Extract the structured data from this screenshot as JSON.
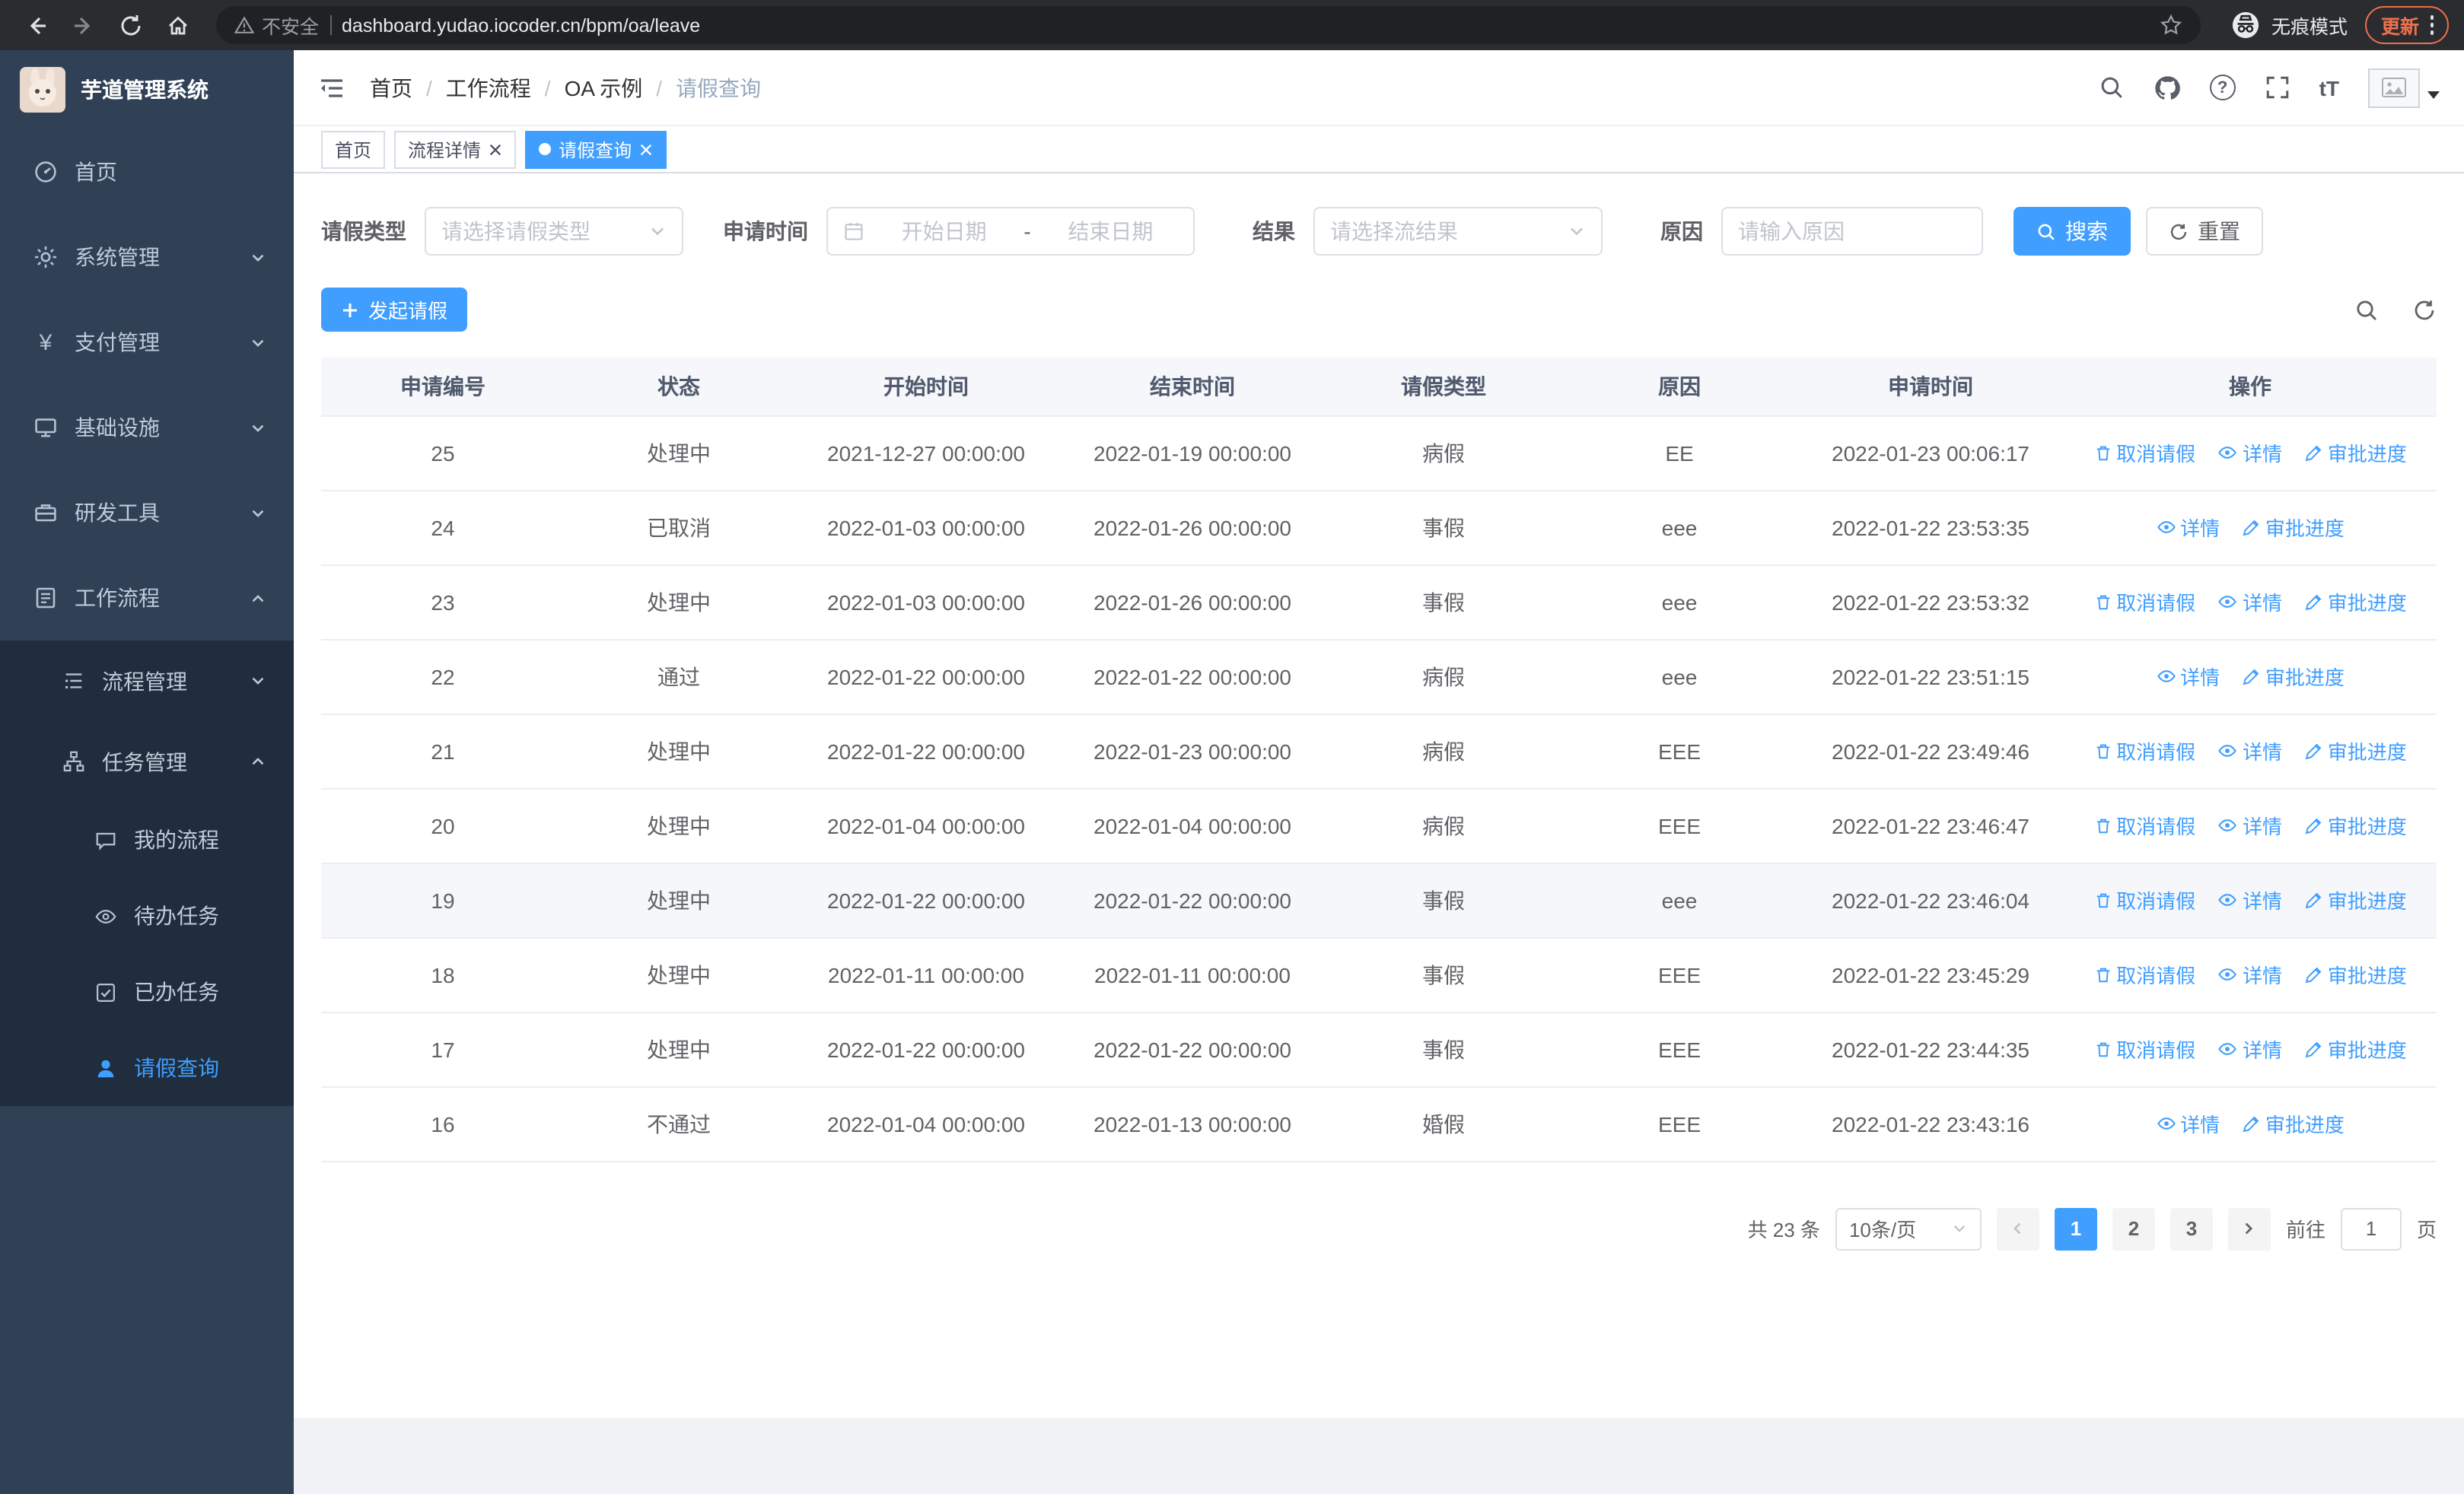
{
  "browser": {
    "security_label": "不安全",
    "url": "dashboard.yudao.iocoder.cn/bpm/oa/leave",
    "incognito_label": "无痕模式",
    "update_label": "更新"
  },
  "sidebar": {
    "title": "芋道管理系统",
    "yen_glyph": "¥",
    "items": [
      {
        "label": "首页"
      },
      {
        "label": "系统管理"
      },
      {
        "label": "支付管理"
      },
      {
        "label": "基础设施"
      },
      {
        "label": "研发工具"
      },
      {
        "label": "工作流程"
      },
      {
        "label": "流程管理"
      },
      {
        "label": "任务管理"
      },
      {
        "label": "我的流程"
      },
      {
        "label": "待办任务"
      },
      {
        "label": "已办任务"
      },
      {
        "label": "请假查询"
      }
    ]
  },
  "breadcrumb": [
    "首页",
    "工作流程",
    "OA 示例",
    "请假查询"
  ],
  "breadcrumb_sep": "/",
  "header_icons": {
    "help_glyph": "?",
    "font_glyph": "tT"
  },
  "tabs": [
    {
      "label": "首页"
    },
    {
      "label": "流程详情"
    },
    {
      "label": "请假查询"
    }
  ],
  "filters": {
    "leave_type_label": "请假类型",
    "leave_type_placeholder": "请选择请假类型",
    "time_label": "申请时间",
    "start_date_placeholder": "开始日期",
    "range_separator": "-",
    "end_date_placeholder": "结束日期",
    "result_label": "结果",
    "result_placeholder": "请选择流结果",
    "reason_label": "原因",
    "reason_placeholder": "请输入原因",
    "search_button": "搜索",
    "reset_button": "重置"
  },
  "toolbar": {
    "create_label": "发起请假"
  },
  "table": {
    "headers": [
      "申请编号",
      "状态",
      "开始时间",
      "结束时间",
      "请假类型",
      "原因",
      "申请时间",
      "操作"
    ],
    "rows": [
      {
        "id": "25",
        "status": "处理中",
        "start": "2021-12-27 00:00:00",
        "end": "2022-01-19 00:00:00",
        "type": "病假",
        "reason": "EE",
        "applied": "2022-01-23 00:06:17",
        "cancel": "取消请假",
        "details": "详情",
        "progress": "审批进度"
      },
      {
        "id": "24",
        "status": "已取消",
        "start": "2022-01-03 00:00:00",
        "end": "2022-01-26 00:00:00",
        "type": "事假",
        "reason": "eee",
        "applied": "2022-01-22 23:53:35",
        "details": "详情",
        "progress": "审批进度"
      },
      {
        "id": "23",
        "status": "处理中",
        "start": "2022-01-03 00:00:00",
        "end": "2022-01-26 00:00:00",
        "type": "事假",
        "reason": "eee",
        "applied": "2022-01-22 23:53:32",
        "cancel": "取消请假",
        "details": "详情",
        "progress": "审批进度"
      },
      {
        "id": "22",
        "status": "通过",
        "start": "2022-01-22 00:00:00",
        "end": "2022-01-22 00:00:00",
        "type": "病假",
        "reason": "eee",
        "applied": "2022-01-22 23:51:15",
        "details": "详情",
        "progress": "审批进度"
      },
      {
        "id": "21",
        "status": "处理中",
        "start": "2022-01-22 00:00:00",
        "end": "2022-01-23 00:00:00",
        "type": "病假",
        "reason": "EEE",
        "applied": "2022-01-22 23:49:46",
        "cancel": "取消请假",
        "details": "详情",
        "progress": "审批进度"
      },
      {
        "id": "20",
        "status": "处理中",
        "start": "2022-01-04 00:00:00",
        "end": "2022-01-04 00:00:00",
        "type": "病假",
        "reason": "EEE",
        "applied": "2022-01-22 23:46:47",
        "cancel": "取消请假",
        "details": "详情",
        "progress": "审批进度"
      },
      {
        "id": "19",
        "status": "处理中",
        "start": "2022-01-22 00:00:00",
        "end": "2022-01-22 00:00:00",
        "type": "事假",
        "reason": "eee",
        "applied": "2022-01-22 23:46:04",
        "cancel": "取消请假",
        "details": "详情",
        "progress": "审批进度"
      },
      {
        "id": "18",
        "status": "处理中",
        "start": "2022-01-11 00:00:00",
        "end": "2022-01-11 00:00:00",
        "type": "事假",
        "reason": "EEE",
        "applied": "2022-01-22 23:45:29",
        "cancel": "取消请假",
        "details": "详情",
        "progress": "审批进度"
      },
      {
        "id": "17",
        "status": "处理中",
        "start": "2022-01-22 00:00:00",
        "end": "2022-01-22 00:00:00",
        "type": "事假",
        "reason": "EEE",
        "applied": "2022-01-22 23:44:35",
        "cancel": "取消请假",
        "details": "详情",
        "progress": "审批进度"
      },
      {
        "id": "16",
        "status": "不通过",
        "start": "2022-01-04 00:00:00",
        "end": "2022-01-13 00:00:00",
        "type": "婚假",
        "reason": "EEE",
        "applied": "2022-01-22 23:43:16",
        "details": "详情",
        "progress": "审批进度"
      }
    ]
  },
  "pagination": {
    "total_text": "共 23 条",
    "page_size": "10条/页",
    "pages": [
      "1",
      "2",
      "3"
    ],
    "current_page": "1",
    "goto_label": "前往",
    "goto_value": "1",
    "page_unit": "页"
  },
  "accent_color": "#409EFF"
}
